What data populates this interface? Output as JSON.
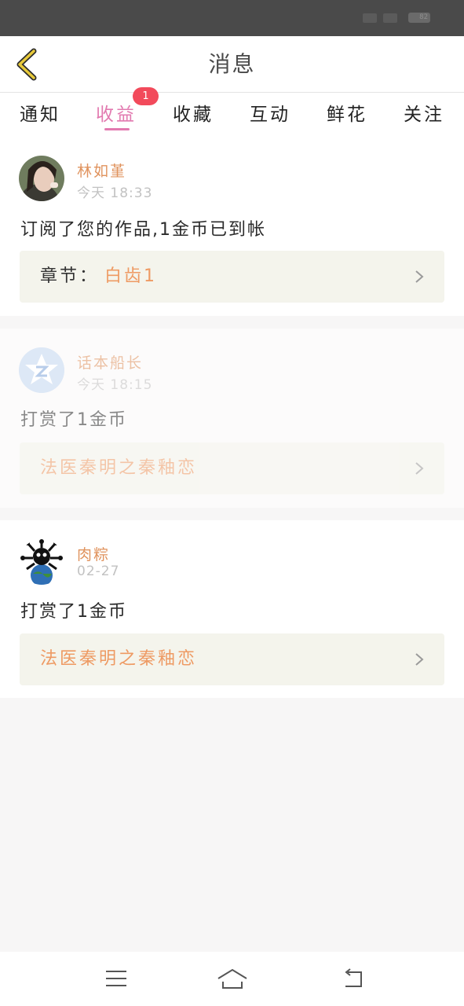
{
  "status_bar": {
    "battery": "82"
  },
  "header": {
    "title": "消息",
    "back_icon": "chevron-left-icon"
  },
  "tabs": [
    {
      "label": "通知",
      "active": false
    },
    {
      "label": "收益",
      "active": true,
      "badge": "1"
    },
    {
      "label": "收藏",
      "active": false
    },
    {
      "label": "互动",
      "active": false
    },
    {
      "label": "鲜花",
      "active": false
    },
    {
      "label": "关注",
      "active": false
    }
  ],
  "messages": [
    {
      "user": "林如堇",
      "time": "今天 18:33",
      "text": "订阅了您的作品,1金币已到帐",
      "link_prefix": "章节：",
      "link_title": "白齿1"
    },
    {
      "user": "话本船长",
      "time": "今天 18:15",
      "text": "打赏了1金币",
      "link_prefix": "",
      "link_title": "法医秦明之秦釉恋"
    },
    {
      "user": "肉粽",
      "time": "02-27",
      "text": "打赏了1金币",
      "link_prefix": "",
      "link_title": "法医秦明之秦釉恋"
    }
  ],
  "nav_bar": {
    "menu_icon": "menu-icon",
    "home_icon": "home-icon",
    "back_icon": "back-arrow-icon"
  },
  "colors": {
    "accent": "#e27ab0",
    "username": "#e0935e",
    "link_title": "#ee9a63",
    "badge": "#f24a5b",
    "back_icon": "#c9a227"
  }
}
